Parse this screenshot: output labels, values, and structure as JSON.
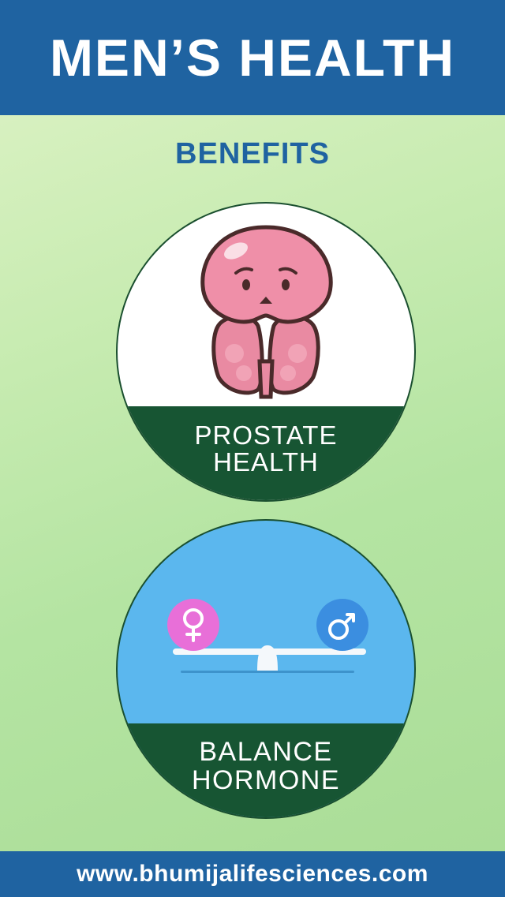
{
  "header": {
    "title": "MEN’S HEALTH"
  },
  "subtitle": "BENEFITS",
  "benefits": [
    {
      "line1": "PROSTATE",
      "line2": "HEALTH",
      "icon": "prostate-icon"
    },
    {
      "line1": "BALANCE",
      "line2": "HORMONE",
      "icon": "hormone-balance-icon"
    }
  ],
  "footer": {
    "website": "www.bhumijalifesciences.com"
  },
  "colors": {
    "brand_blue": "#1f63a1",
    "band_green": "#175533",
    "sky_blue": "#5bb7ee",
    "female_pink": "#e86fd8",
    "male_blue": "#3b8ee0"
  }
}
